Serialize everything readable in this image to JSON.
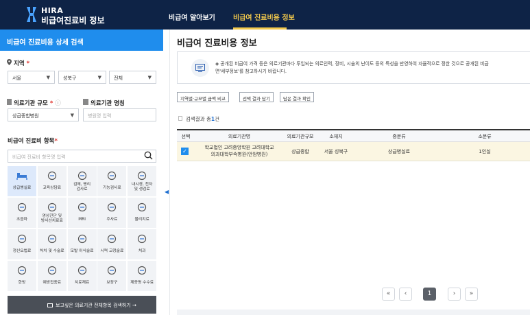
{
  "brand": {
    "name": "HIRA",
    "sub": "비급여진료비 정보"
  },
  "nav": [
    {
      "label": "비급여 알아보기"
    },
    {
      "label": "비급여 진료비용 정보"
    }
  ],
  "sidebar": {
    "title": "비급여 진료비용 상세 검색",
    "region_label": "지역",
    "region": [
      "서울",
      "성북구",
      "전체"
    ],
    "scale_label": "의료기관 규모",
    "scale_value": "상급종합병원",
    "hospname_label": "의료기관 명칭",
    "hospname_placeholder": "병원명 입력",
    "item_label": "비급여 진료비 항목",
    "item_placeholder": "비급여 진료비 항목명 입력",
    "categories": [
      {
        "label": "상급병실료",
        "selected": true,
        "icon": "bed-icon"
      },
      {
        "label": "교육상담료",
        "icon": "consult-icon"
      },
      {
        "label": "검체, 병리\n검사료",
        "icon": "microscope-icon"
      },
      {
        "label": "기능검사료",
        "icon": "function-test-icon"
      },
      {
        "label": "내시경, 천자\n및 생검료",
        "icon": "endoscope-icon"
      },
      {
        "label": "초음파",
        "icon": "ultrasound-icon"
      },
      {
        "label": "영상진단 및\n방사선치료료",
        "icon": "xray-icon"
      },
      {
        "label": "MRI",
        "icon": "mri-icon"
      },
      {
        "label": "주사료",
        "icon": "syringe-icon"
      },
      {
        "label": "물리치료",
        "icon": "physio-icon"
      },
      {
        "label": "정신요법료",
        "icon": "brain-icon"
      },
      {
        "label": "처치 및 수술료",
        "icon": "surgery-icon"
      },
      {
        "label": "모발 이식술료",
        "icon": "hair-icon"
      },
      {
        "label": "시력 교정술료",
        "icon": "eye-icon"
      },
      {
        "label": "치과",
        "icon": "tooth-icon"
      },
      {
        "label": "한방",
        "icon": "herbal-icon"
      },
      {
        "label": "예방접종료",
        "icon": "vaccine-icon"
      },
      {
        "label": "치료재료",
        "icon": "material-icon"
      },
      {
        "label": "보장구",
        "icon": "wheelchair-icon"
      },
      {
        "label": "제증명 수수료",
        "icon": "certificate-icon"
      }
    ],
    "search_all_label": "보고싶은 의료기관 전체항목 검색하기"
  },
  "main": {
    "title": "비급여 진료비용 정보",
    "notice_line1": "◈ 공개된 비급여 가격 등은 의료기관마다 투입되는 의료인력, 장비, 시술의 난이도 등의 특성을 반영하여 자율적으로 정한 것으로 공개된 비급",
    "notice_line2": "면'세부정보'를 참고하시기 바랍니다.",
    "buttons": [
      "지역별·규모별 금액 비교",
      "선택 결과 담기",
      "담은 결과 확인"
    ],
    "result_prefix": "검색결과 총",
    "result_count": "1",
    "result_suffix": "건",
    "columns": [
      "선택",
      "의료기관명",
      "의료기관규모",
      "소재지",
      "중분류",
      "소분류"
    ],
    "rows": [
      {
        "name_line1": "학교법인 고려중앙학원 고려대학교",
        "name_line2": "의과대학부속병원(안암병원)",
        "scale": "상급종합",
        "location": "서울 성북구",
        "mid": "상급병실료",
        "small": "1인실"
      }
    ],
    "pager": {
      "first": "«",
      "prev": "‹",
      "current": "1",
      "next": "›",
      "last": "»"
    }
  },
  "colors": {
    "navy": "#0e2346",
    "accent": "#1f8ded",
    "gold": "#f2c94c",
    "row_highlight": "#fbf6e2"
  }
}
